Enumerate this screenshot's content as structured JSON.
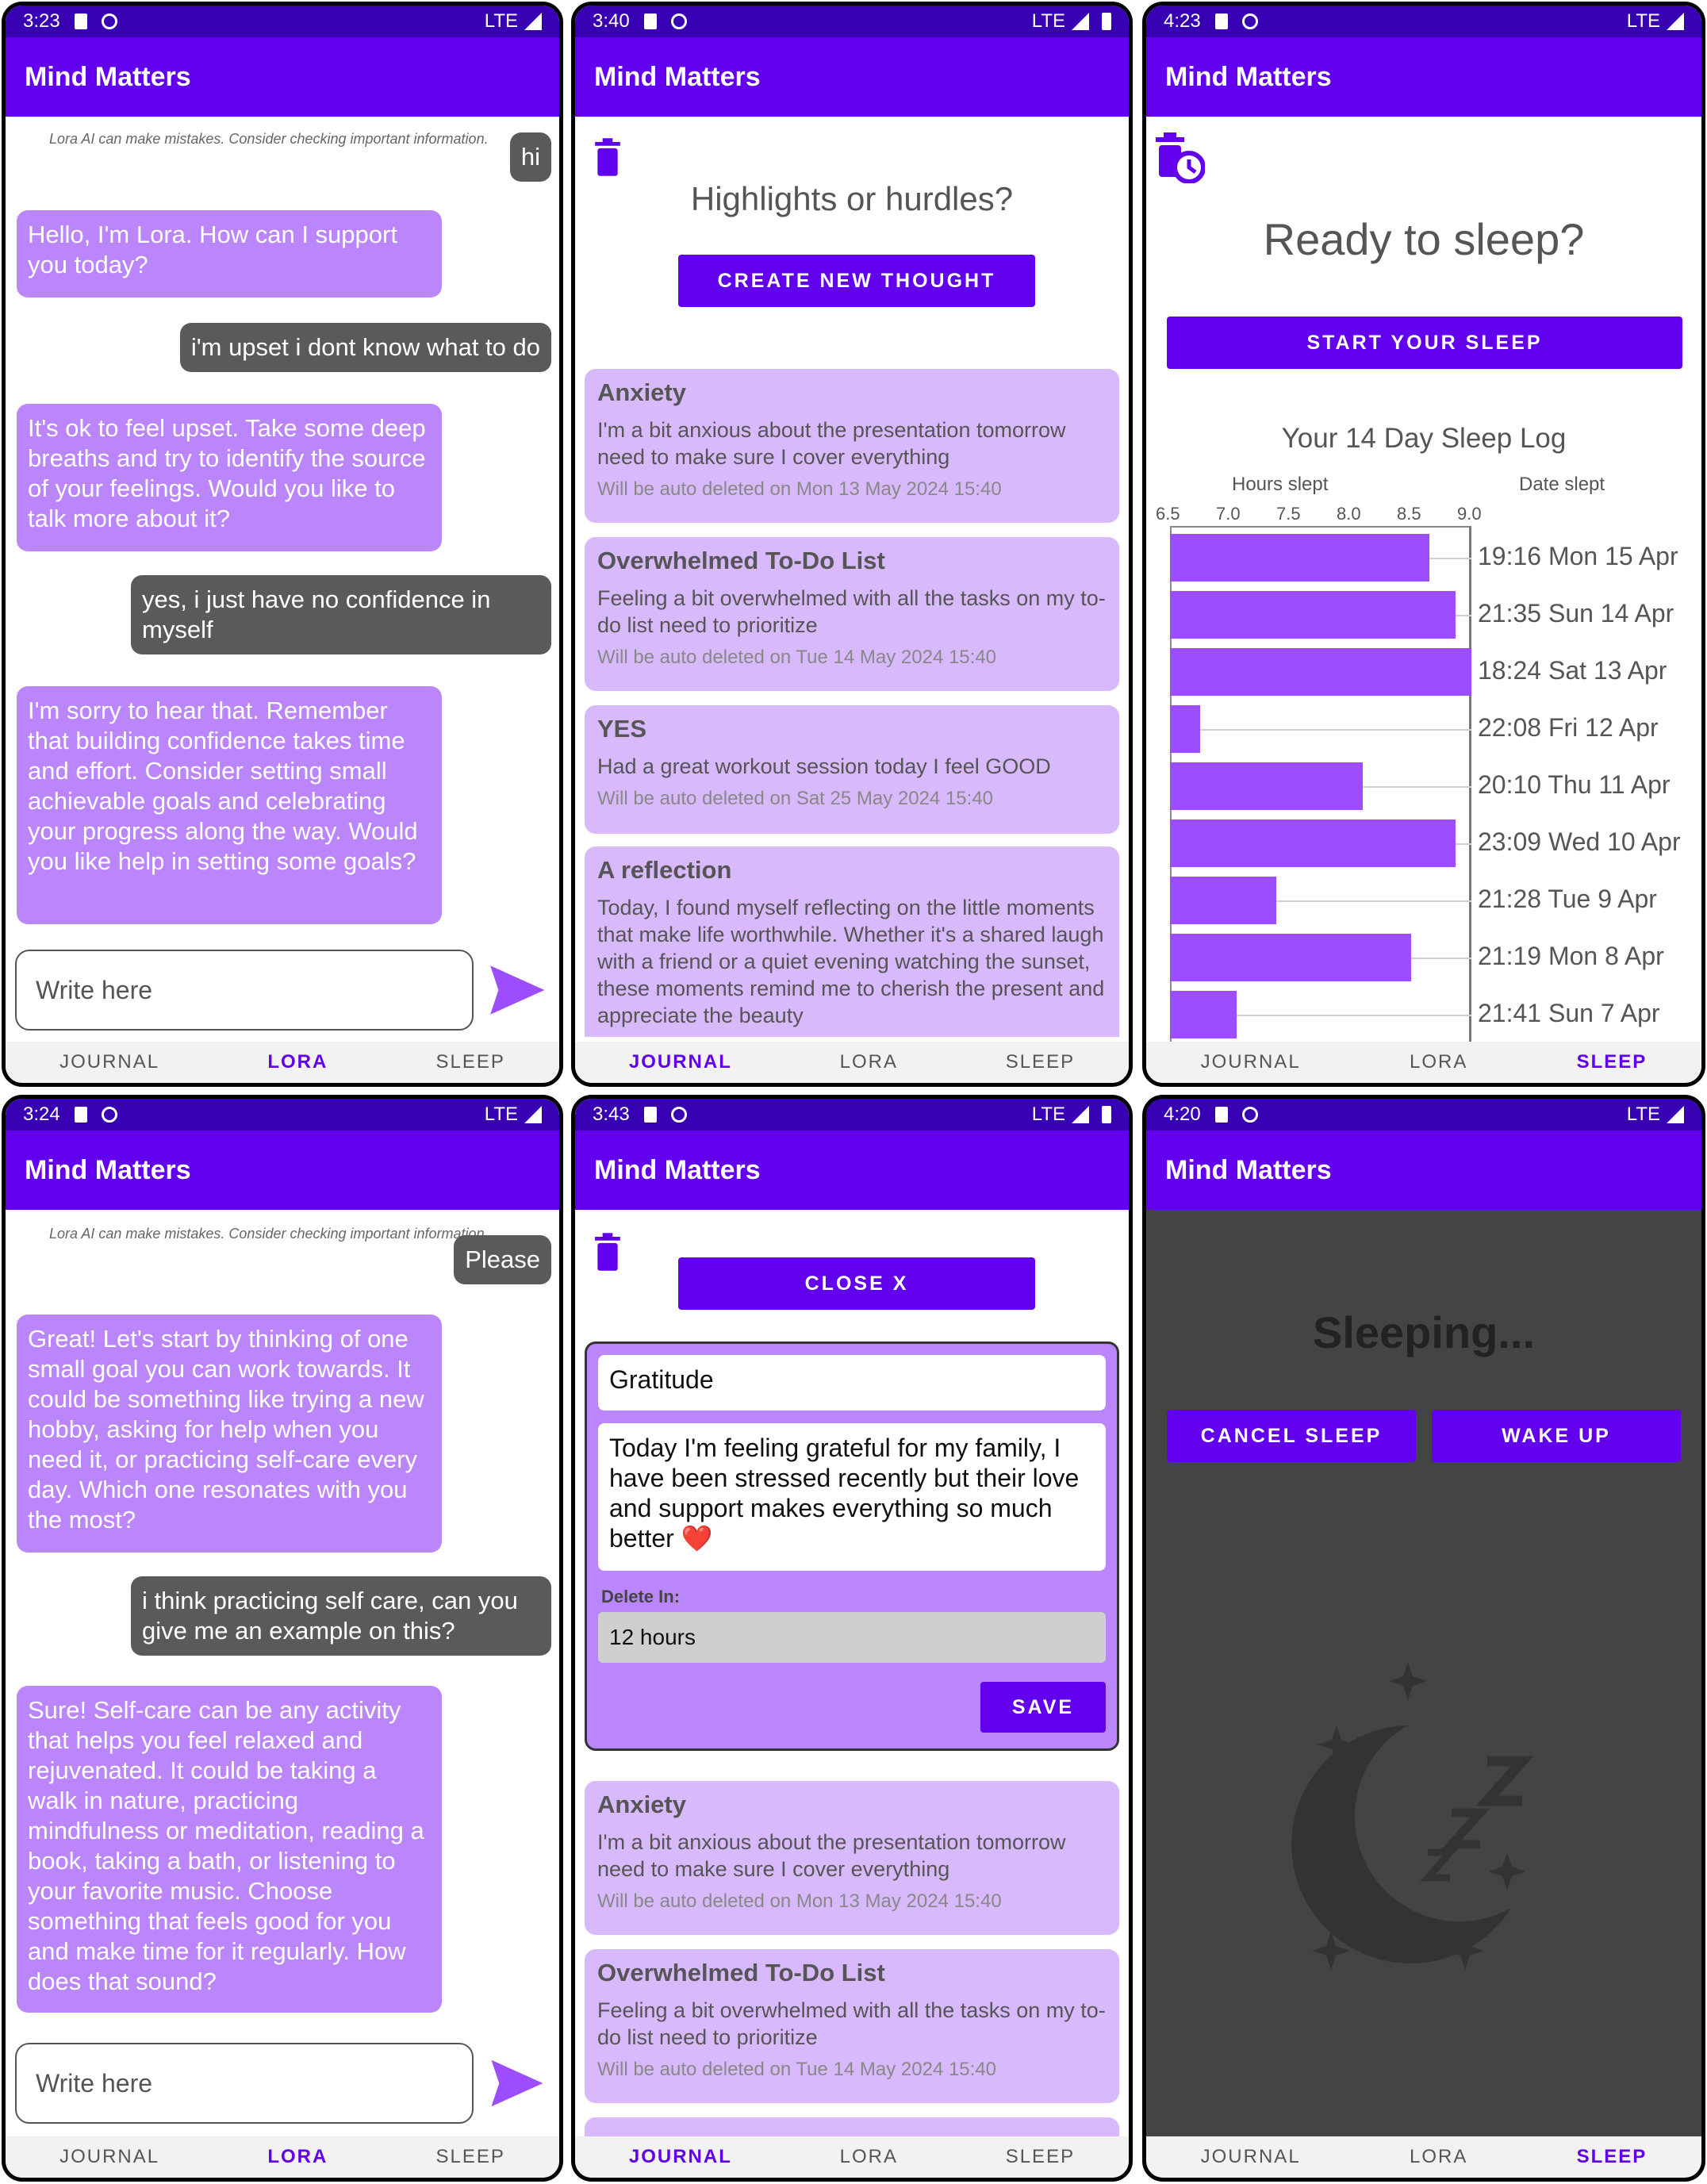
{
  "app": {
    "title": "Mind Matters"
  },
  "nav": {
    "journal": "JOURNAL",
    "lora": "LORA",
    "sleep": "SLEEP"
  },
  "screens": {
    "chat1": {
      "time": "3:23",
      "network": "LTE",
      "disclaimer": "Lora AI can make mistakes. Consider checking important information.",
      "messages": [
        {
          "from": "user",
          "text": "hi"
        },
        {
          "from": "bot",
          "text": "Hello, I'm Lora. How can I support you today?"
        },
        {
          "from": "user",
          "text": "i'm upset i dont know what to do"
        },
        {
          "from": "bot",
          "text": "It's ok to feel upset. Take some deep breaths and try to identify the source of your feelings. Would you like to talk more about it?"
        },
        {
          "from": "user",
          "text": "yes, i just have no confidence in myself"
        },
        {
          "from": "bot",
          "text": "I'm sorry to hear that. Remember that building confidence takes time and effort. Consider setting small achievable goals and celebrating your progress along the way. Would you like help in setting some goals?"
        }
      ],
      "input_placeholder": "Write here"
    },
    "journal1": {
      "time": "3:40",
      "network": "LTE",
      "prompt": "Highlights or hurdles?",
      "create_button": "CREATE NEW THOUGHT",
      "entries": [
        {
          "title": "Anxiety",
          "body": "I'm a bit anxious about the presentation tomorrow need to make sure I cover everything",
          "deleted": "Will be auto deleted on Mon 13 May 2024 15:40"
        },
        {
          "title": "Overwhelmed To-Do List",
          "body": "Feeling a bit overwhelmed with all the tasks on my to-do list need to prioritize",
          "deleted": "Will be auto deleted on Tue 14 May 2024 15:40"
        },
        {
          "title": "YES",
          "body": "Had a great workout session today I feel GOOD",
          "deleted": "Will be auto deleted on Sat 25 May 2024 15:40"
        },
        {
          "title": "A reflection",
          "body": "Today, I found myself reflecting on the little moments that make life worthwhile. Whether it's a shared laugh with a friend or a quiet evening watching the sunset, these moments remind me to cherish the present and appreciate the beauty",
          "deleted": ""
        }
      ]
    },
    "sleep1": {
      "time": "4:23",
      "network": "LTE",
      "title": "Ready to sleep?",
      "start_button": "START YOUR SLEEP"
    },
    "chat2": {
      "time": "3:24",
      "network": "LTE",
      "disclaimer": "Lora AI can make mistakes. Consider checking important information.",
      "messages": [
        {
          "from": "user",
          "text": "Please"
        },
        {
          "from": "bot",
          "text": "Great! Let's start by thinking of one small goal you can work towards. It could be something like trying a new hobby, asking for help when you need it, or practicing self-care every day. Which one resonates with you the most?"
        },
        {
          "from": "user",
          "text": "i think practicing self care, can you give me an example on this?"
        },
        {
          "from": "bot",
          "text": "Sure! Self-care can be any activity that helps you feel relaxed and rejuvenated. It could be taking a walk in nature, practicing mindfulness or meditation, reading a book, taking a bath, or listening to your favorite music. Choose something that feels good for you and make time for it regularly. How does that sound?"
        }
      ],
      "input_placeholder": "Write here"
    },
    "journal2": {
      "time": "3:43",
      "network": "LTE",
      "close_button": "CLOSE X",
      "editor": {
        "title_value": "Gratitude",
        "body_value": "Today I'm feeling grateful for my family, I have been stressed recently but their love and support makes everything so much better ❤️",
        "delete_label": "Delete In:",
        "delete_value": "12 hours",
        "save_button": "SAVE"
      },
      "entries": [
        {
          "title": "Anxiety",
          "body": "I'm a bit anxious about the presentation tomorrow need to make sure I cover everything",
          "deleted": "Will be auto deleted on Mon 13 May 2024 15:40"
        },
        {
          "title": "Overwhelmed To-Do List",
          "body": "Feeling a bit overwhelmed with all the tasks on my to-do list need to prioritize",
          "deleted": "Will be auto deleted on Tue 14 May 2024 15:40"
        }
      ]
    },
    "sleep2": {
      "time": "4:20",
      "network": "LTE",
      "title": "Sleeping...",
      "cancel_button": "CANCEL SLEEP",
      "wake_button": "WAKE UP"
    }
  },
  "chart_data": {
    "type": "bar",
    "title": "Your 14 Day Sleep Log",
    "xlabel": "Hours slept",
    "ylabel": "Date slept",
    "xlim": [
      6.5,
      9.0
    ],
    "xticks": [
      "6.5",
      "7.0",
      "7.5",
      "8.0",
      "8.5",
      "9.0"
    ],
    "categories": [
      "19:16 Mon 15 Apr",
      "21:35 Sun 14 Apr",
      "18:24 Sat 13 Apr",
      "22:08 Fri 12 Apr",
      "20:10 Thu 11 Apr",
      "23:09 Wed 10 Apr",
      "21:28 Tue 9 Apr",
      "21:19 Mon 8 Apr",
      "21:41 Sun 7 Apr"
    ],
    "values": [
      8.65,
      8.87,
      9.0,
      6.75,
      8.1,
      8.87,
      7.38,
      8.5,
      7.05
    ],
    "color": "#9c4dff"
  },
  "colors": {
    "primary": "#6200ee",
    "status": "#3700b3",
    "bot_bubble": "#bb86fc",
    "user_bubble": "#5a5a5a",
    "card": "#d7b9fc"
  }
}
